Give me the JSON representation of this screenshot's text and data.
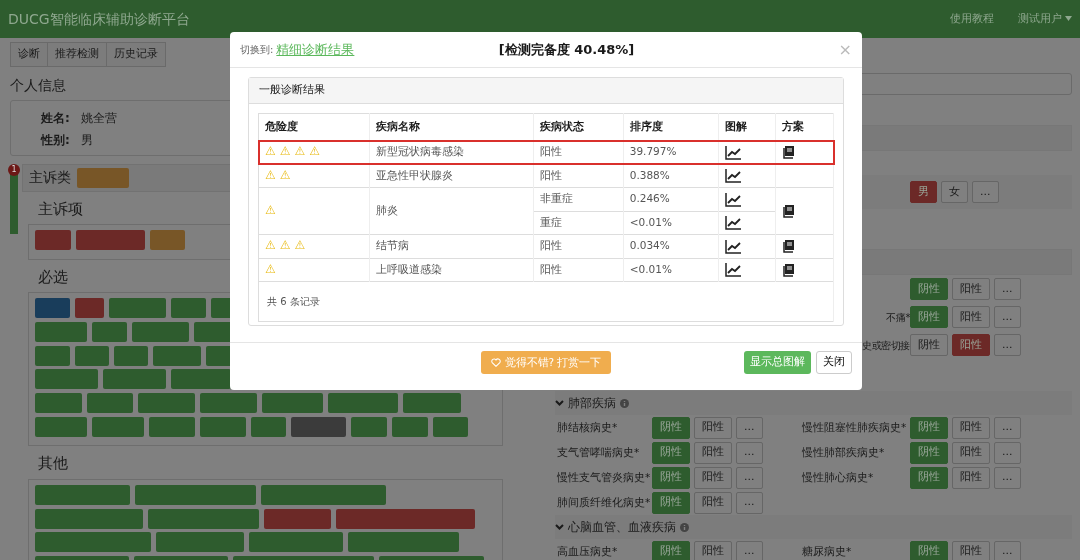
{
  "navbar": {
    "brand": "DUCG智能临床辅助诊断平台",
    "links": [
      "使用教程"
    ],
    "user_menu": "测试用户"
  },
  "tabs": [
    "诊断",
    "推荐检测",
    "历史记录"
  ],
  "personal_info": {
    "title": "个人信息",
    "fields": [
      {
        "label": "姓名:",
        "value": "姚全营"
      },
      {
        "label": "性别:",
        "value": "男"
      }
    ]
  },
  "side_badge": "1",
  "complaint": {
    "title": "主诉类",
    "subsections": [
      {
        "title": "主诉项",
        "rows": [
          [
            {
              "color": "#6c2927"
            },
            {
              "color": "#6c2927"
            },
            {
              "color": "#785627"
            }
          ]
        ]
      },
      {
        "title": "必选",
        "rows": [
          [
            {
              "color": "#193d5b"
            },
            {
              "color": "#6c2927"
            },
            {
              "color": "#2e5c2e"
            },
            {
              "color": "#2e5c2e"
            },
            {
              "color": "#2e5c2e"
            }
          ],
          [
            {
              "color": "#2e5c2e"
            },
            {
              "color": "#2e5c2e"
            },
            {
              "color": "#2e5c2e"
            },
            {
              "color": "#2e5c2e"
            }
          ],
          [
            {
              "color": "#2e5c2e"
            },
            {
              "color": "#2e5c2e"
            },
            {
              "color": "#2e5c2e"
            },
            {
              "color": "#2e5c2e"
            },
            {
              "color": "#2e5c2e"
            }
          ],
          [
            {
              "color": "#2e5c2e"
            },
            {
              "color": "#2e5c2e"
            },
            {
              "color": "#2e5c2e"
            }
          ],
          [
            {
              "color": "#2e5c2e"
            },
            {
              "color": "#2e5c2e"
            },
            {
              "color": "#2e5c2e"
            },
            {
              "color": "#2e5c2e"
            },
            {
              "color": "#2e5c2e"
            },
            {
              "color": "#2e5c2e"
            },
            {
              "color": "#2e5c2e"
            }
          ],
          [
            {
              "color": "#2e5c2e"
            },
            {
              "color": "#2e5c2e"
            },
            {
              "color": "#2e5c2e"
            },
            {
              "color": "#2e5c2e"
            },
            {
              "color": "#2e5c2e"
            },
            {
              "color": "#3b3b3b"
            },
            {
              "color": "#2e5c2e"
            },
            {
              "color": "#2e5c2e"
            },
            {
              "color": "#2e5c2e"
            }
          ]
        ]
      },
      {
        "title": "其他",
        "rows": [
          [
            {
              "color": "#2e5c2e"
            },
            {
              "color": "#2e5c2e"
            },
            {
              "color": "#2e5c2e"
            }
          ],
          [
            {
              "color": "#2e5c2e"
            },
            {
              "color": "#2e5c2e"
            },
            {
              "color": "#6c2927"
            },
            {
              "color": "#6c2927"
            }
          ],
          [
            {
              "color": "#2e5c2e"
            },
            {
              "color": "#2e5c2e"
            },
            {
              "color": "#2e5c2e"
            },
            {
              "color": "#2e5c2e"
            }
          ],
          [
            {
              "color": "#2e5c2e"
            },
            {
              "color": "#2e5c2e"
            },
            {
              "color": "#2e5c2e"
            },
            {
              "color": "#2e5c2e"
            }
          ]
        ]
      }
    ]
  },
  "upper_rows": [
    {
      "options": [
        {
          "label": "男",
          "selected": true,
          "color": "#6c2927"
        },
        {
          "label": "女",
          "selected": false
        },
        {
          "label": "...",
          "selected": false
        }
      ]
    },
    {
      "options": [
        {
          "label": "阴性",
          "selected": true,
          "color": "#2e5c2e"
        },
        {
          "label": "阳性",
          "selected": false
        },
        {
          "label": "...",
          "selected": false
        }
      ]
    },
    {
      "label": "不痛*",
      "options": [
        {
          "label": "阴性",
          "selected": true,
          "color": "#2e5c2e"
        },
        {
          "label": "阳性",
          "selected": false
        },
        {
          "label": "...",
          "selected": false
        }
      ]
    },
    {
      "label": "史或密切接",
      "options": [
        {
          "label": "阴性",
          "selected": false
        },
        {
          "label": "阳性",
          "selected": true,
          "color": "#6c2927"
        },
        {
          "label": "...",
          "selected": false
        }
      ]
    }
  ],
  "sections": [
    {
      "title": "肺部疾病",
      "rows": [
        {
          "label": "肺结核病史*",
          "options": [
            {
              "label": "阴性",
              "selected": true,
              "color": "#2e5c2e"
            },
            {
              "label": "阳性",
              "selected": false
            },
            {
              "label": "...",
              "selected": false
            }
          ]
        },
        {
          "label": "慢性阻塞性肺疾病史*",
          "options": [
            {
              "label": "阴性",
              "selected": true,
              "color": "#2e5c2e"
            },
            {
              "label": "阳性",
              "selected": false
            },
            {
              "label": "...",
              "selected": false
            }
          ]
        },
        {
          "label": "支气管哮喘病史*",
          "options": [
            {
              "label": "阴性",
              "selected": true,
              "color": "#2e5c2e"
            },
            {
              "label": "阳性",
              "selected": false
            },
            {
              "label": "...",
              "selected": false
            }
          ]
        },
        {
          "label": "慢性肺部疾病史*",
          "options": [
            {
              "label": "阴性",
              "selected": true,
              "color": "#2e5c2e"
            },
            {
              "label": "阳性",
              "selected": false
            },
            {
              "label": "...",
              "selected": false
            }
          ]
        },
        {
          "label": "慢性支气管炎病史*",
          "options": [
            {
              "label": "阴性",
              "selected": true,
              "color": "#2e5c2e"
            },
            {
              "label": "阳性",
              "selected": false
            },
            {
              "label": "...",
              "selected": false
            }
          ]
        },
        {
          "label": "慢性肺心病史*",
          "options": [
            {
              "label": "阴性",
              "selected": true,
              "color": "#2e5c2e"
            },
            {
              "label": "阳性",
              "selected": false
            },
            {
              "label": "...",
              "selected": false
            }
          ]
        },
        {
          "label": "肺间质纤维化病史*",
          "options": [
            {
              "label": "阴性",
              "selected": true,
              "color": "#2e5c2e"
            },
            {
              "label": "阳性",
              "selected": false
            },
            {
              "label": "...",
              "selected": false
            }
          ]
        }
      ]
    },
    {
      "title": "心脑血管、血液疾病",
      "rows": [
        {
          "label": "高血压病史*",
          "options": [
            {
              "label": "阴性",
              "selected": true,
              "color": "#2e5c2e"
            },
            {
              "label": "阳性",
              "selected": false
            },
            {
              "label": "...",
              "selected": false
            }
          ]
        },
        {
          "label": "糖尿病史*",
          "options": [
            {
              "label": "阴性",
              "selected": true,
              "color": "#2e5c2e"
            },
            {
              "label": "阳性",
              "selected": false
            },
            {
              "label": "...",
              "selected": false
            }
          ]
        }
      ]
    }
  ],
  "modal": {
    "switch_label": "切换到:",
    "switch_link": "精细诊断结果",
    "title": "[检测完备度 40.48%]",
    "close": "×",
    "panel_title": "一般诊断结果",
    "columns": [
      "危险度",
      "疾病名称",
      "疾病状态",
      "排序度",
      "图解",
      "方案"
    ],
    "diseases": [
      {
        "danger": [
          "⚠",
          "⚠",
          "⚠",
          "⚠"
        ],
        "name": "新型冠状病毒感染",
        "highlighted": true,
        "states": [
          {
            "status": "阳性",
            "rank": "39.797%"
          }
        ],
        "plan": true
      },
      {
        "danger": [
          "⚠",
          "⚠"
        ],
        "name": "亚急性甲状腺炎",
        "highlighted": false,
        "states": [
          {
            "status": "阳性",
            "rank": "0.388%"
          }
        ],
        "plan": false
      },
      {
        "danger": [
          "⚠"
        ],
        "name": "肺炎",
        "highlighted": false,
        "states": [
          {
            "status": "非重症",
            "rank": "0.246%"
          },
          {
            "status": "重症",
            "rank": "<0.01%"
          }
        ],
        "plan": true
      },
      {
        "danger": [
          "⚠",
          "⚠",
          "⚠"
        ],
        "name": "结节病",
        "highlighted": false,
        "states": [
          {
            "status": "阳性",
            "rank": "0.034%"
          }
        ],
        "plan": true
      },
      {
        "danger": [
          "⚠"
        ],
        "name": "上呼吸道感染",
        "highlighted": false,
        "states": [
          {
            "status": "阳性",
            "rank": "<0.01%"
          }
        ],
        "plan": true
      }
    ],
    "record_count": "共 6 条记录",
    "buttons": [
      {
        "kind": "reward",
        "label": "觉得不错? 打赏一下"
      },
      {
        "kind": "primary",
        "label": "显示总图解"
      },
      {
        "kind": "default",
        "label": "关闭"
      }
    ]
  }
}
